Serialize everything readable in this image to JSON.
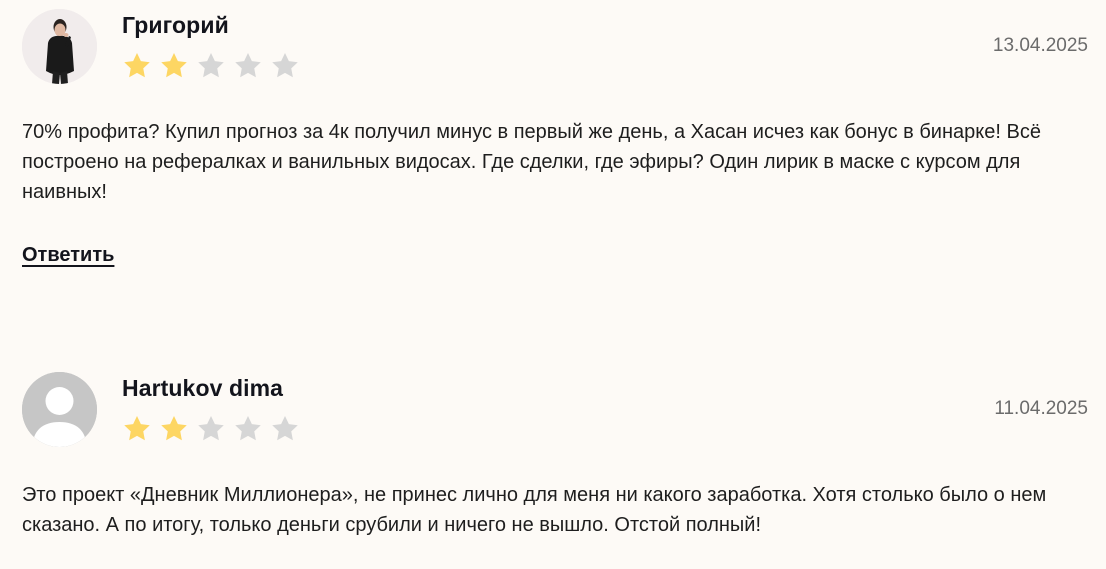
{
  "reviews": [
    {
      "author": "Григорий",
      "rating": 2,
      "max_rating": 5,
      "date": "13.04.2025",
      "text": "70% профита? Купил прогноз за 4к получил минус в первый же день, а Хасан исчез как бонус в бинарке! Всё построено на рефералках и ванильных видосах. Где сделки, где эфиры? Один лирик в маске с курсом для наивных!",
      "reply_label": "Ответить",
      "avatar": "photo"
    },
    {
      "author": "Hartukov dima",
      "rating": 2,
      "max_rating": 5,
      "date": "11.04.2025",
      "text": "Это проект «Дневник Миллионера», не принес лично для меня ни какого заработка. Хотя столько было о нем сказано. А по итогу, только деньги срубили и ничего не вышло. Отстой полный!",
      "avatar": "placeholder"
    }
  ],
  "colors": {
    "star_filled": "#fdd663",
    "star_empty": "#d6d6d6",
    "background": "#fdfaf6"
  }
}
